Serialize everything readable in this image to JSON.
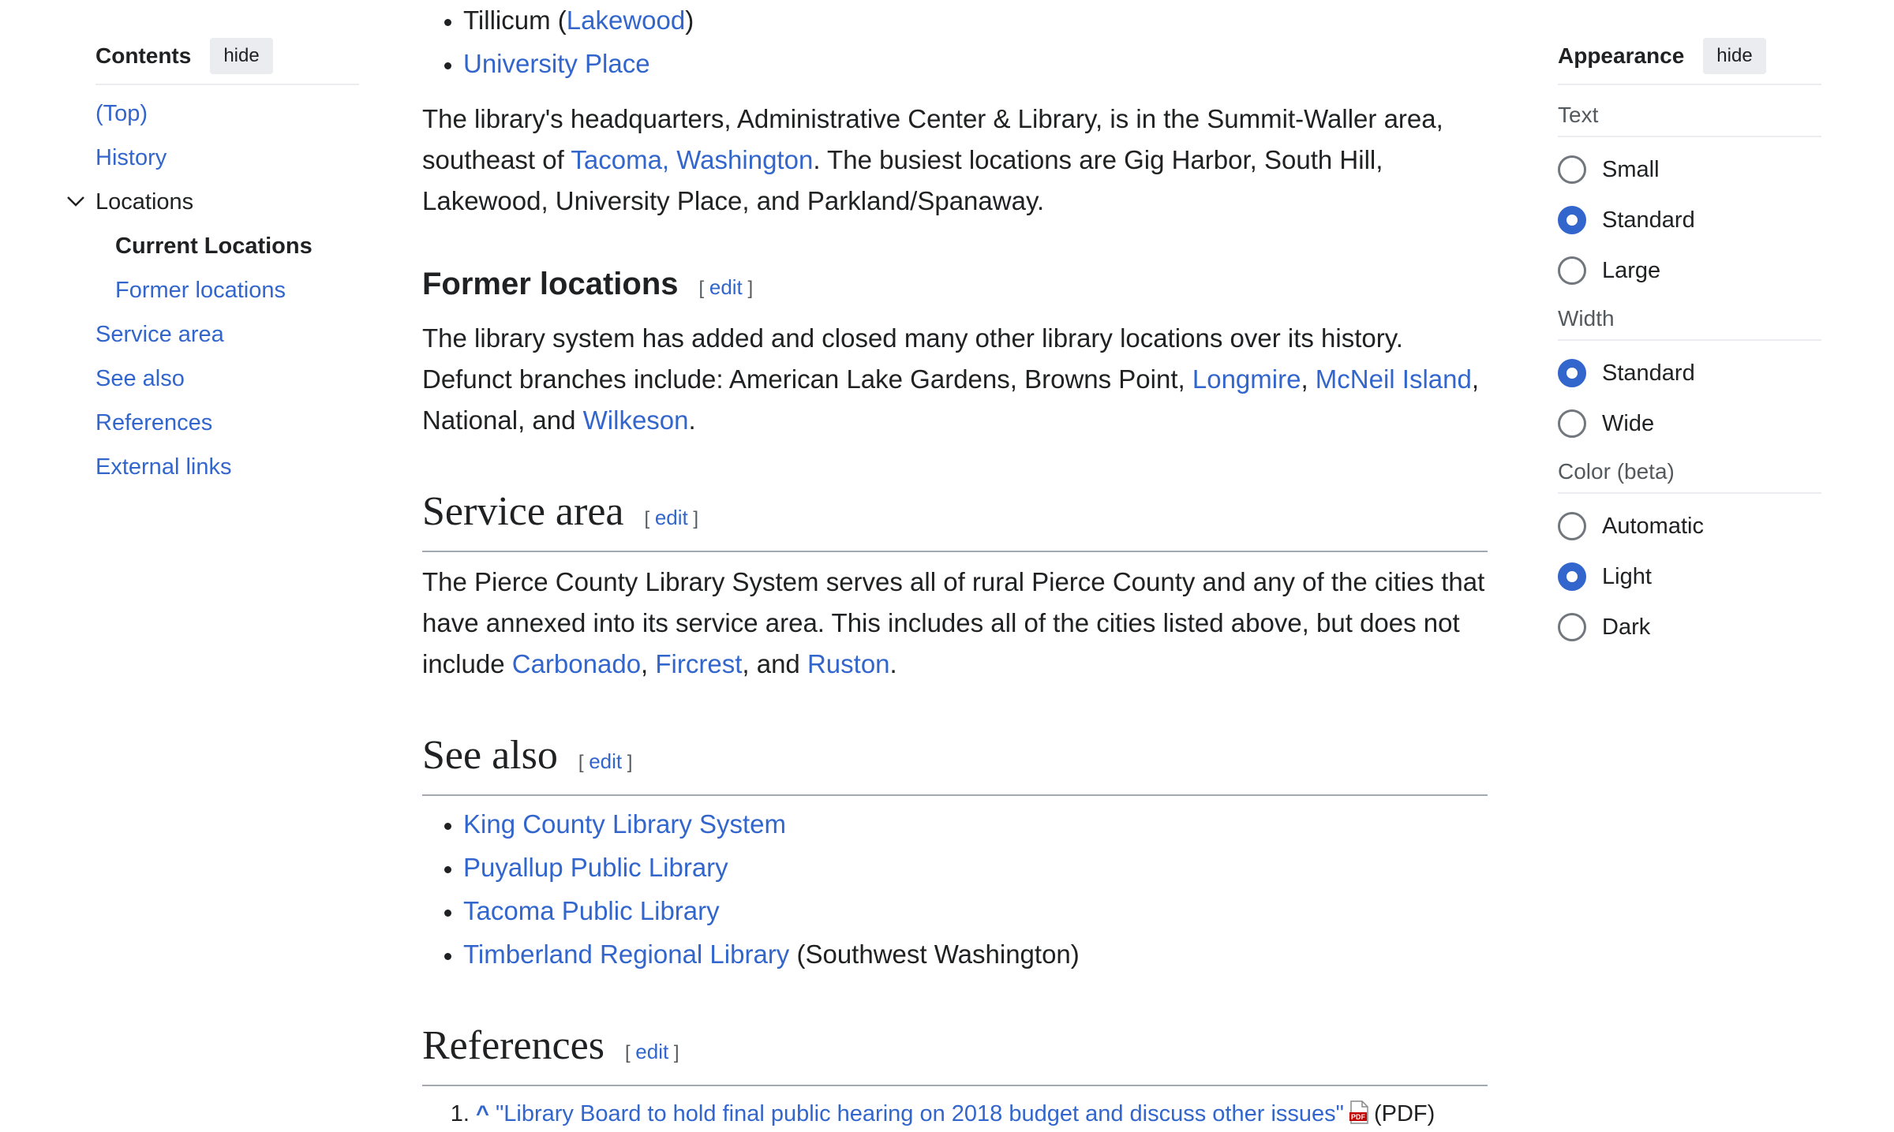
{
  "toc": {
    "title": "Contents",
    "hide_label": "hide",
    "items": [
      {
        "label": "(Top)"
      },
      {
        "label": "History"
      },
      {
        "label": "Locations"
      },
      {
        "label": "Current Locations"
      },
      {
        "label": "Former locations"
      },
      {
        "label": "Service area"
      },
      {
        "label": "See also"
      },
      {
        "label": "References"
      },
      {
        "label": "External links"
      }
    ]
  },
  "content": {
    "top_list": [
      {
        "text_before": "Tillicum (",
        "link": "Lakewood",
        "text_after": ")"
      },
      {
        "link": "University Place"
      }
    ],
    "hq_para": {
      "part1": "The library's headquarters, Administrative Center & Library, is in the Summit-Waller area, southeast of ",
      "link": "Tacoma, Washington",
      "part2": ". The busiest locations are Gig Harbor, South Hill, Lakewood, University Place, and Parkland/Spanaway."
    },
    "former": {
      "heading": "Former locations",
      "edit_open": "[",
      "edit_label": "edit",
      "edit_close": "]",
      "part1": "The library system has added and closed many other library locations over its history. Defunct branches include: American Lake Gardens, Browns Point, ",
      "link1": "Longmire",
      "sep1": ", ",
      "link2": "McNeil Island",
      "part2": ", National, and ",
      "link3": "Wilkeson",
      "part3": "."
    },
    "service": {
      "heading": "Service area",
      "edit_label": "edit",
      "part1": "The Pierce County Library System serves all of rural Pierce County and any of the cities that have annexed into its service area. This includes all of the cities listed above, but does not include ",
      "link1": "Carbonado",
      "sep1": ", ",
      "link2": "Fircrest",
      "sep2": ", and ",
      "link3": "Ruston",
      "part2": "."
    },
    "see_also": {
      "heading": "See also",
      "edit_label": "edit",
      "items": [
        {
          "link": "King County Library System",
          "after": ""
        },
        {
          "link": "Puyallup Public Library",
          "after": ""
        },
        {
          "link": "Tacoma Public Library",
          "after": ""
        },
        {
          "link": "Timberland Regional Library",
          "after": " (Southwest Washington)"
        }
      ]
    },
    "references": {
      "heading": "References",
      "edit_label": "edit",
      "items": [
        {
          "caret": "^",
          "link": "\"Library Board to hold final public hearing on 2018 budget and discuss other issues\"",
          "format": "(PDF)"
        }
      ]
    }
  },
  "appearance": {
    "title": "Appearance",
    "hide_label": "hide",
    "text_group": {
      "label": "Text",
      "options": [
        "Small",
        "Standard",
        "Large"
      ],
      "selected": "Standard"
    },
    "width_group": {
      "label": "Width",
      "options": [
        "Standard",
        "Wide"
      ],
      "selected": "Standard"
    },
    "color_group": {
      "label": "Color (beta)",
      "options": [
        "Automatic",
        "Light",
        "Dark"
      ],
      "selected": "Light"
    }
  },
  "colors": {
    "link": "#3366cc",
    "text": "#202122",
    "radio_checked": "#3366cc"
  }
}
